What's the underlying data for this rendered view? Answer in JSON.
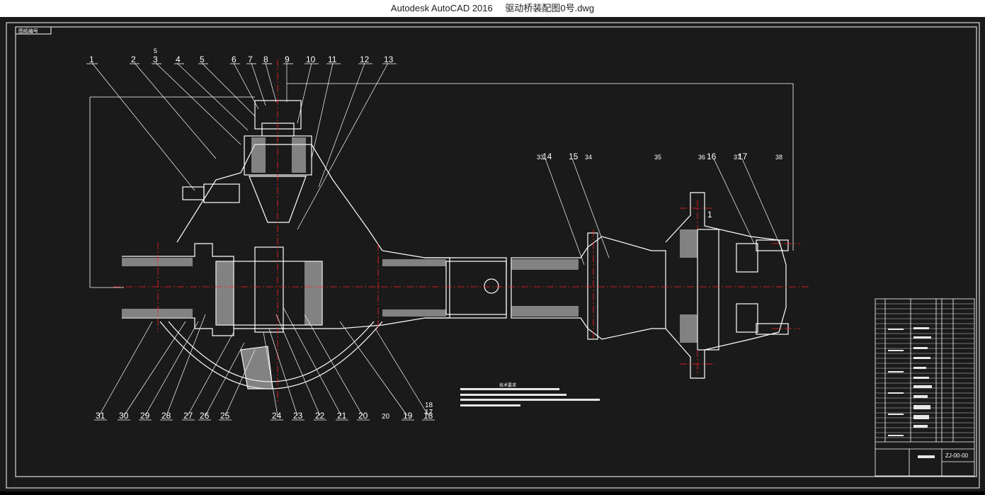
{
  "window": {
    "app_title": "Autodesk AutoCAD 2016",
    "file_name": "驱动桥装配图0号.dwg"
  },
  "drawing": {
    "colors": {
      "background": "#1a1a1a",
      "line": "#ffffff",
      "centerline": "#ff2020",
      "hatch": "#cfcfcf"
    },
    "frame_tag": "图纸编号",
    "balloons_top": [
      "1",
      "2",
      "3",
      "4",
      "5",
      "6",
      "7",
      "8",
      "9",
      "10",
      "11",
      "12",
      "13"
    ],
    "balloons_top_extra": [
      "5"
    ],
    "balloons_bottom": [
      "31",
      "30",
      "29",
      "28",
      "27",
      "26",
      "25",
      "24",
      "23",
      "22",
      "21",
      "20",
      "19",
      "18"
    ],
    "bottom_extra_labels": [
      "20",
      "18",
      "17"
    ],
    "balloons_right": [
      "14",
      "15",
      "16",
      "17"
    ],
    "right_small_labels": [
      "33",
      "34",
      "35",
      "36",
      "37",
      "38"
    ],
    "flange_label": "1",
    "tech_requirements_title": "技术要求",
    "title_block_code": "ZJ-00-00"
  }
}
